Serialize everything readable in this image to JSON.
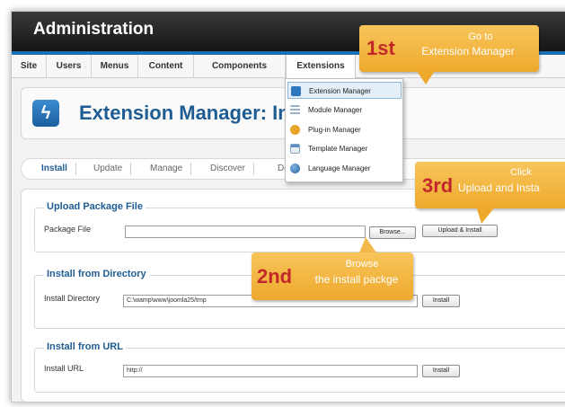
{
  "header": {
    "title": "Administration"
  },
  "menu": {
    "items": [
      "Site",
      "Users",
      "Menus",
      "Content",
      "Components",
      "Extensions"
    ],
    "active": "Extensions"
  },
  "dropdown": {
    "items": [
      {
        "label": "Extension Manager",
        "icon": "extension-icon"
      },
      {
        "label": "Module Manager",
        "icon": "module-icon"
      },
      {
        "label": "Plug-in Manager",
        "icon": "plugin-icon"
      },
      {
        "label": "Template Manager",
        "icon": "template-icon"
      },
      {
        "label": "Language Manager",
        "icon": "language-icon"
      }
    ]
  },
  "page": {
    "title": "Extension Manager: Insta"
  },
  "subnav": {
    "items": [
      "Install",
      "Update",
      "Manage",
      "Discover",
      "De"
    ]
  },
  "upload": {
    "legend": "Upload Package File",
    "label": "Package File",
    "value": "",
    "browse_label": "Browse...",
    "submit_label": "Upload & Install"
  },
  "directory": {
    "legend": "Install from Directory",
    "label": "Install Directory",
    "value": "C:\\wamp\\www\\joomla25/tmp",
    "submit_label": "Install"
  },
  "url": {
    "legend": "Install from URL",
    "label": "Install URL",
    "value": "http://",
    "submit_label": "Install"
  },
  "callouts": [
    {
      "step": "1st",
      "lines": [
        "Go to",
        "Extension Manager"
      ]
    },
    {
      "step": "2nd",
      "lines": [
        "Browse",
        "the install packge"
      ]
    },
    {
      "step": "3rd",
      "lines": [
        "Click",
        "Upload and Insta"
      ]
    }
  ],
  "colors": {
    "admin_bar": "#1e1e1e",
    "accent_blue": "#1b6fb3",
    "title_blue": "#1f5c93",
    "callout_orange": "#f2b441",
    "callout_number_red": "#c2282a"
  }
}
